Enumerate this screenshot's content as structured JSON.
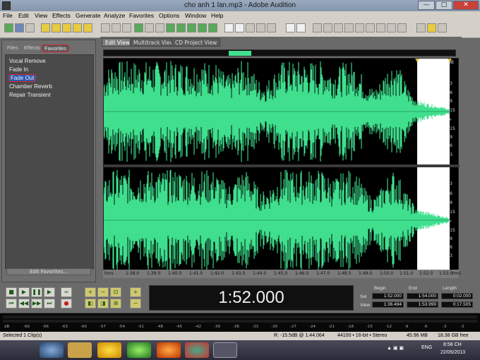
{
  "window": {
    "title": "cho anh 1 lan.mp3 - Adobe Audition",
    "min": "—",
    "max": "□",
    "close": "✕"
  },
  "menu": [
    "File",
    "Edit",
    "View",
    "Effects",
    "Generate",
    "Analyze",
    "Favorites",
    "Options",
    "Window",
    "Help"
  ],
  "left_panel": {
    "tabs": [
      "Files",
      "Effects",
      "Favorites"
    ],
    "active_tab": "Favorites",
    "items": [
      "Vocal Remove",
      "Fade In",
      "Fade Out",
      "Chamber Reverb",
      "Repair Transient"
    ],
    "selected_item": "Fade Out",
    "edit_button": "Edit Favorites..."
  },
  "view_tabs": [
    "Edit View",
    "Multitrack View",
    "CD Project View"
  ],
  "active_view_tab": "Edit View",
  "db_scale_top": [
    "dB",
    "-3",
    "-6",
    "-9",
    "-15",
    "∞",
    "-15",
    "-9",
    "-6",
    "-3"
  ],
  "db_scale_bottom": [
    "-3",
    "-6",
    "-9",
    "-15",
    "∞",
    "-15",
    "-9",
    "-6",
    "-3"
  ],
  "ruler": {
    "start": "hms",
    "end": "hms",
    "labels": [
      "1:38.0",
      "1:39.0",
      "1:40.0",
      "1:41.0",
      "1:42.0",
      "1:43.0",
      "1:44.0",
      "1:45.0",
      "1:46.0",
      "1:47.0",
      "1:48.0",
      "1:49.0",
      "1:50.0",
      "1:51.0",
      "1:52.0",
      "1:53.0"
    ]
  },
  "time_display": "1:52.000",
  "selection": {
    "headers": [
      "Begin",
      "End",
      "Length"
    ],
    "sel_label": "Sel",
    "view_label": "View",
    "sel": [
      "1:52.000",
      "1:54.000",
      "0:02.000"
    ],
    "view": [
      "1:36.494",
      "1:53.999",
      "0:17.505"
    ]
  },
  "level_meter": [
    "dB",
    "-69",
    "-66",
    "-63",
    "-60",
    "-57",
    "-54",
    "-51",
    "-48",
    "-45",
    "-42",
    "-39",
    "-36",
    "-33",
    "-30",
    "-27",
    "-24",
    "-21",
    "-18",
    "-15",
    "-12",
    "-9",
    "-6",
    "-3",
    "0"
  ],
  "status": {
    "clips": "Selected 1 Clip(s)",
    "readout": "R: -15.5dB @  1:44.064",
    "format": "44100 • 16-bit • Stereo",
    "size": "45.96 MB",
    "free": "18.38 GB free"
  },
  "taskbar": {
    "lang": "ENG",
    "time": "8:58 CH",
    "date": "22/05/2013"
  },
  "colors": {
    "waveform": "#3fdf8e",
    "selection": "#ffffff",
    "background": "#000000"
  }
}
